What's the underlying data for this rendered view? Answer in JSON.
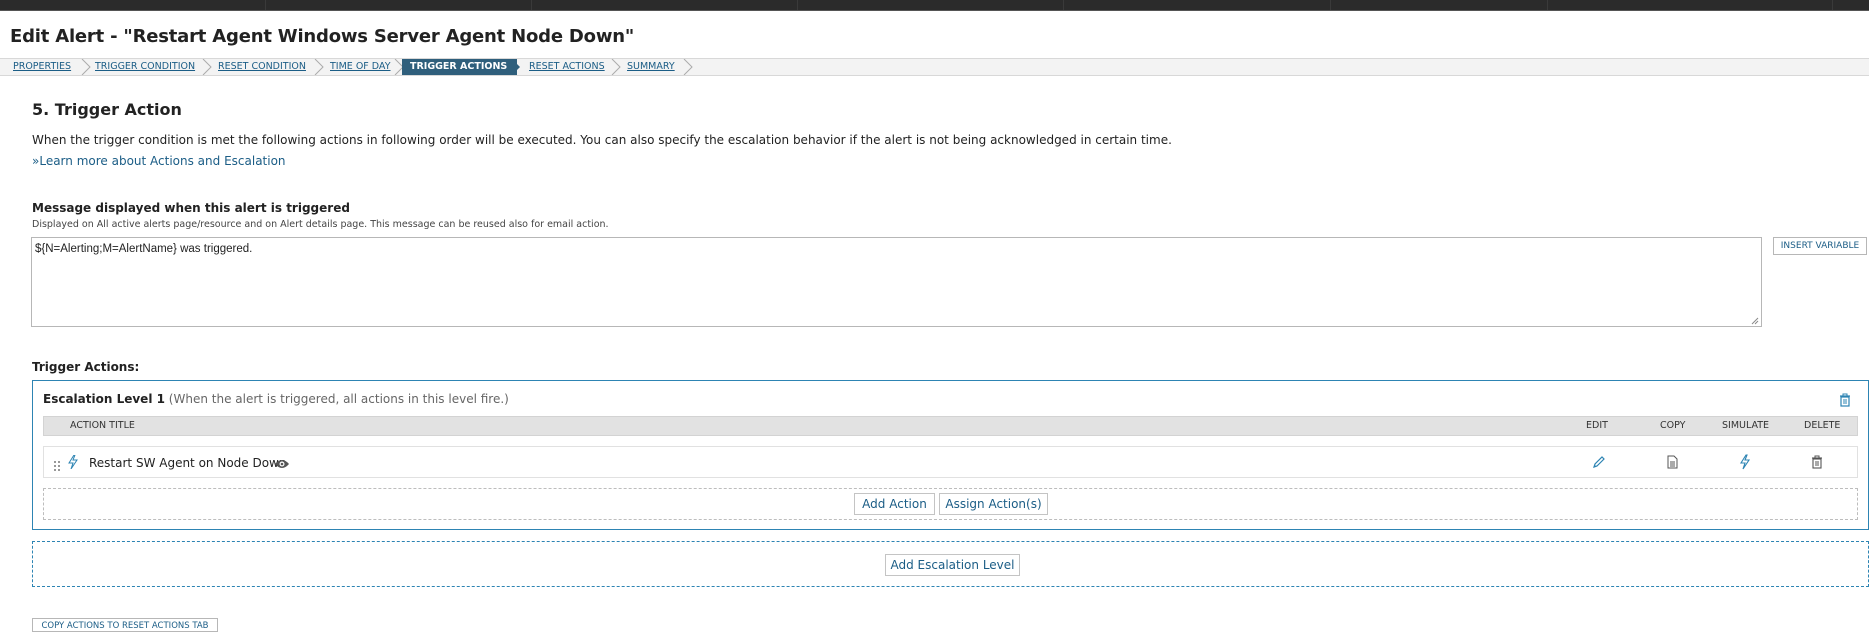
{
  "page": {
    "title": "Edit Alert - \"Restart Agent Windows Server Agent Node Down\""
  },
  "wizard": {
    "steps": [
      {
        "label": "PROPERTIES"
      },
      {
        "label": "TRIGGER CONDITION"
      },
      {
        "label": "RESET CONDITION"
      },
      {
        "label": "TIME OF DAY"
      },
      {
        "label": "TRIGGER ACTIONS",
        "active": true
      },
      {
        "label": "RESET ACTIONS"
      },
      {
        "label": "SUMMARY"
      }
    ]
  },
  "section": {
    "title": "5. Trigger Action",
    "description": "When the trigger condition is met the following actions in following order will be executed. You can also specify the escalation behavior if the alert is not being acknowledged in certain time.",
    "learn_link": "»Learn more about Actions and Escalation"
  },
  "message": {
    "label": "Message displayed when this alert is triggered",
    "sublabel": "Displayed on All active alerts page/resource and on Alert details page. This message can be reused also for email action.",
    "value": "${N=Alerting;M=AlertName} was triggered.",
    "insert_variable": "INSERT VARIABLE"
  },
  "trigger_actions": {
    "label": "Trigger Actions:",
    "escalation": {
      "title": "Escalation Level 1",
      "note": "(When the alert is triggered, all actions in this level fire.)",
      "columns": {
        "title": "ACTION TITLE",
        "edit": "EDIT",
        "copy": "COPY",
        "simulate": "SIMULATE",
        "delete": "DELETE"
      },
      "rows": [
        {
          "title": "Restart SW Agent on Node Down"
        }
      ],
      "add_action": "Add Action",
      "assign_actions": "Assign Action(s)"
    },
    "add_escalation_level": "Add Escalation Level",
    "copy_to_reset": "COPY ACTIONS TO RESET ACTIONS TAB"
  },
  "colors": {
    "accent": "#2d84b3",
    "link": "#1b5d86",
    "active_step": "#2f5f7c"
  }
}
